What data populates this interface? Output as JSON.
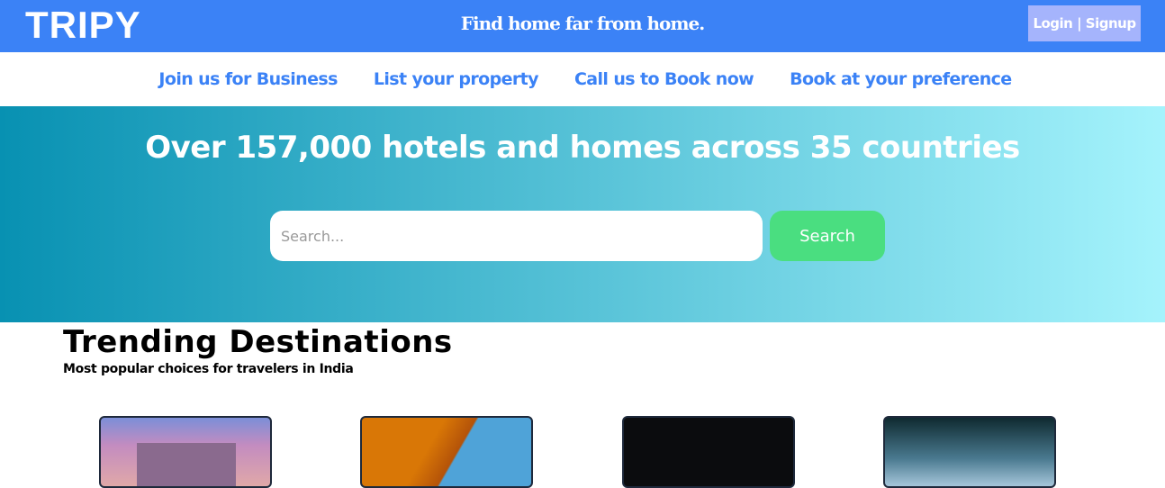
{
  "header": {
    "logo": "TRIPY",
    "tagline": "Find home far from home.",
    "login_label": "Login | Signup"
  },
  "nav": [
    "Join us for Business",
    "List your property",
    "Call us to Book now",
    "Book at your preference"
  ],
  "hero": {
    "title": "Over 157,000 hotels and homes across 35 countries",
    "search_placeholder": "Search...",
    "search_button": "Search"
  },
  "trending": {
    "title": "Trending Destinations",
    "subtitle": "Most popular choices for travelers in India"
  },
  "colors": {
    "brand": "#3b82f6",
    "search_button": "#4ade80",
    "login_bg": "#a5b4fc"
  }
}
